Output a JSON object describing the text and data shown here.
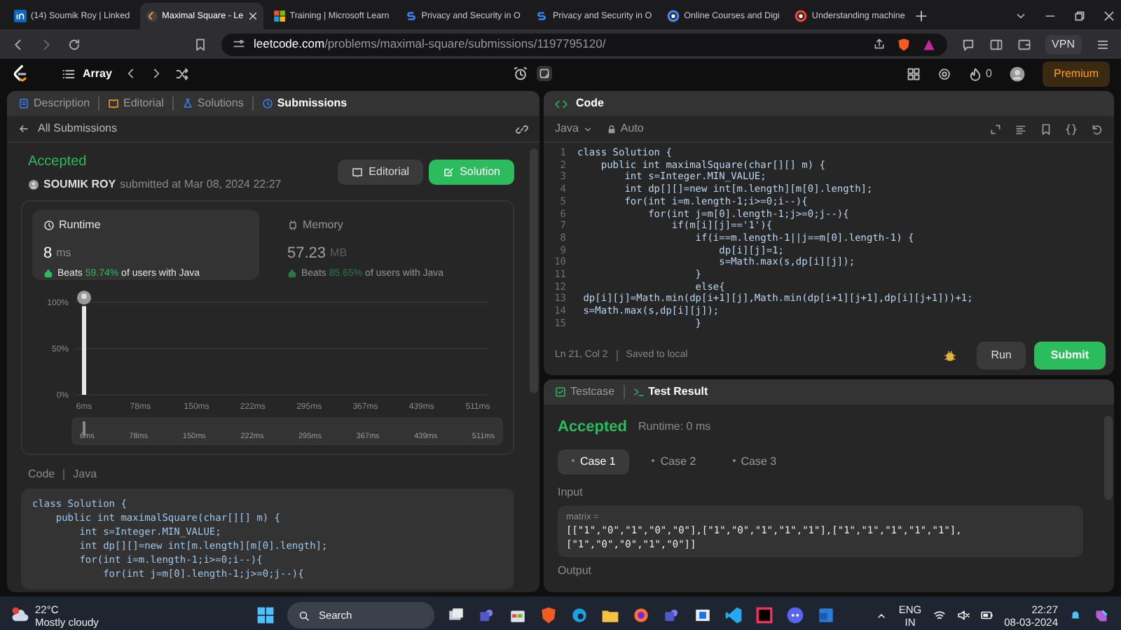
{
  "browser": {
    "tabs": [
      {
        "title": "(14) Soumik Roy | Linked",
        "selected": false
      },
      {
        "title": "Maximal Square - Le",
        "selected": true
      },
      {
        "title": "Training | Microsoft Learn",
        "selected": false
      },
      {
        "title": "Privacy and Security in O",
        "selected": false
      },
      {
        "title": "Privacy and Security in O",
        "selected": false
      },
      {
        "title": "Online Courses and Digi",
        "selected": false
      },
      {
        "title": "Understanding machine",
        "selected": false
      }
    ],
    "url_host": "leetcode.com",
    "url_path": "/problems/maximal-square/submissions/1197795120/",
    "vpn": "VPN"
  },
  "nav": {
    "problem_list": "Array",
    "streak": "0",
    "premium": "Premium"
  },
  "left_tabs": [
    {
      "label": "Description",
      "selected": false
    },
    {
      "label": "Editorial",
      "selected": false
    },
    {
      "label": "Solutions",
      "selected": false
    },
    {
      "label": "Submissions",
      "selected": true
    }
  ],
  "back_link": "All Submissions",
  "submission": {
    "status": "Accepted",
    "user": "SOUMIK ROY",
    "submitted": "submitted at Mar 08, 2024 22:27",
    "editorial_button": "Editorial",
    "solution_button": "Solution"
  },
  "stats": [
    {
      "title": "Runtime",
      "value": "8",
      "unit": "ms",
      "beats": "Beats",
      "percent": "59.74%",
      "rest": "of users with Java",
      "selected": true
    },
    {
      "title": "Memory",
      "value": "57.23",
      "unit": "MB",
      "beats": "Beats",
      "percent": "85.65%",
      "rest": "of users with Java",
      "selected": false
    }
  ],
  "chart_data": {
    "type": "bar",
    "categories": [
      "6ms",
      "78ms",
      "150ms",
      "222ms",
      "295ms",
      "367ms",
      "439ms",
      "511ms"
    ],
    "values": [
      96,
      null,
      null,
      null,
      null,
      null,
      null,
      null
    ],
    "ylim": [
      0,
      100
    ],
    "yticks": [
      {
        "value": 0,
        "label": "0%"
      },
      {
        "value": 50,
        "label": "50%"
      },
      {
        "value": 100,
        "label": "100%"
      }
    ]
  },
  "navigator_labels": [
    "6ms",
    "78ms",
    "150ms",
    "222ms",
    "295ms",
    "367ms",
    "439ms",
    "511ms"
  ],
  "code_view": {
    "title": "Code",
    "language": "Java",
    "lines": [
      "class Solution {",
      "    public int maximalSquare(char[][] m) {",
      "        int s=Integer.MIN_VALUE;",
      "        int dp[][]=new int[m.length][m[0].length];",
      "        for(int i=m.length-1;i>=0;i--){",
      "            for(int j=m[0].length-1;j>=0;j--){"
    ]
  },
  "editor": {
    "title": "Code",
    "language": "Java",
    "mode": "Auto",
    "lines": [
      {
        "n": "1",
        "code": "class Solution {"
      },
      {
        "n": "2",
        "code": "    public int maximalSquare(char[][] m) {"
      },
      {
        "n": "3",
        "code": "        int s=Integer.MIN_VALUE;"
      },
      {
        "n": "4",
        "code": "        int dp[][]=new int[m.length][m[0].length];"
      },
      {
        "n": "5",
        "code": "        for(int i=m.length-1;i>=0;i--){"
      },
      {
        "n": "6",
        "code": "            for(int j=m[0].length-1;j>=0;j--){"
      },
      {
        "n": "7",
        "code": "                if(m[i][j]=='1'){"
      },
      {
        "n": "8",
        "code": "                    if(i==m.length-1||j==m[0].length-1) {"
      },
      {
        "n": "9",
        "code": "                        dp[i][j]=1;"
      },
      {
        "n": "10",
        "code": "                        s=Math.max(s,dp[i][j]);"
      },
      {
        "n": "11",
        "code": "                    }"
      },
      {
        "n": "12",
        "code": "                    else{"
      },
      {
        "n": "13",
        "code": " dp[i][j]=Math.min(dp[i+1][j],Math.min(dp[i+1][j+1],dp[i][j+1]))+1;"
      },
      {
        "n": "14",
        "code": " s=Math.max(s,dp[i][j]);"
      },
      {
        "n": "15",
        "code": "                    }"
      }
    ],
    "cursor": "Ln 21, Col 2",
    "saved": "Saved to local",
    "run": "Run",
    "submit": "Submit"
  },
  "result": {
    "tabs": [
      {
        "label": "Testcase",
        "selected": false
      },
      {
        "label": "Test Result",
        "selected": true
      }
    ],
    "status": "Accepted",
    "runtime": "Runtime: 0 ms",
    "cases": [
      {
        "label": "Case 1",
        "selected": true
      },
      {
        "label": "Case 2",
        "selected": false
      },
      {
        "label": "Case 3",
        "selected": false
      }
    ],
    "input_label": "Input",
    "var_name": "matrix =",
    "value_lines": [
      "[[\"1\",\"0\",\"1\",\"0\",\"0\"],[\"1\",\"0\",\"1\",\"1\",\"1\"],[\"1\",\"1\",\"1\",\"1\",\"1\"],",
      "[\"1\",\"0\",\"0\",\"1\",\"0\"]]"
    ],
    "output_label": "Output"
  },
  "taskbar": {
    "temperature": "22°C",
    "weather": "Mostly cloudy",
    "search": "Search",
    "language": "ENG",
    "region": "IN",
    "time": "22:27",
    "date": "08-03-2024"
  }
}
